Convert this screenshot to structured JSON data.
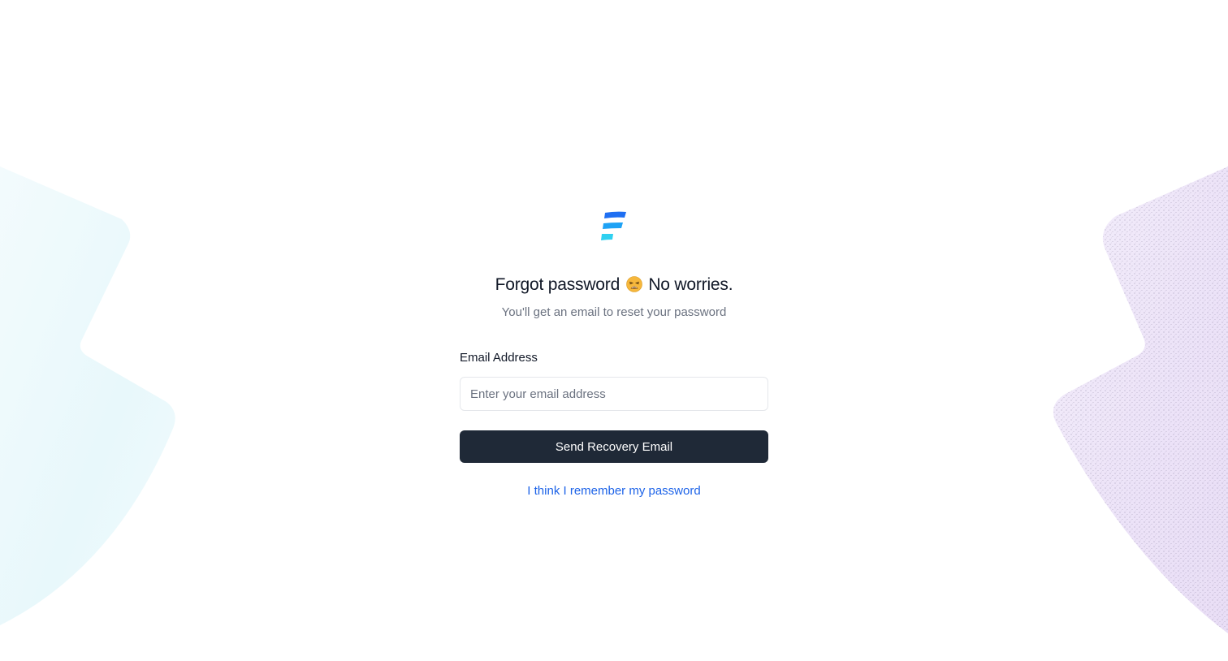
{
  "colors": {
    "primary_text": "#111827",
    "muted_text": "#6b7280",
    "button_bg": "#1f2937",
    "link": "#1d63e8",
    "logo_bars": [
      "#1f6ff2",
      "#1ea2f5",
      "#2fd0f0"
    ],
    "bg_left_tint": "#e6f8fb",
    "bg_right_tint": "#ece4f8"
  },
  "icons": {
    "logo": "brand-stripes-icon",
    "emoji": "weary-face-icon"
  },
  "heading": {
    "before_emoji": "Forgot password",
    "after_emoji": "No worries."
  },
  "subtitle": "You'll get an email to reset your password",
  "form": {
    "email_label": "Email Address",
    "email_placeholder": "Enter your email address",
    "email_value": "",
    "submit_label": "Send Recovery Email"
  },
  "footer_link": "I think I remember my password"
}
